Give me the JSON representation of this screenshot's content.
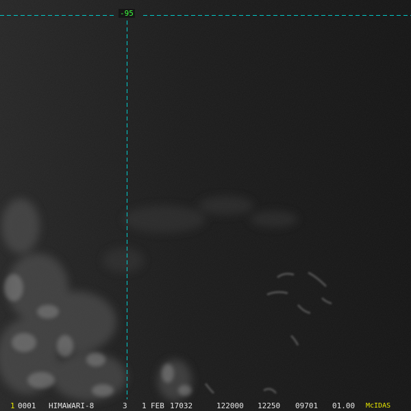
{
  "overlay": {
    "longitude_label": "-95",
    "grid_color": "#00cccc",
    "label_color": "#3cff3c"
  },
  "status": {
    "frame_number": "1",
    "fields": [
      "0001",
      "HIMAWARI-8",
      "3",
      "1",
      "FEB",
      "17032",
      "122000",
      "12250",
      "09701",
      "01.00"
    ],
    "brand": "McIDAS",
    "brand_color": "#e8e800"
  }
}
